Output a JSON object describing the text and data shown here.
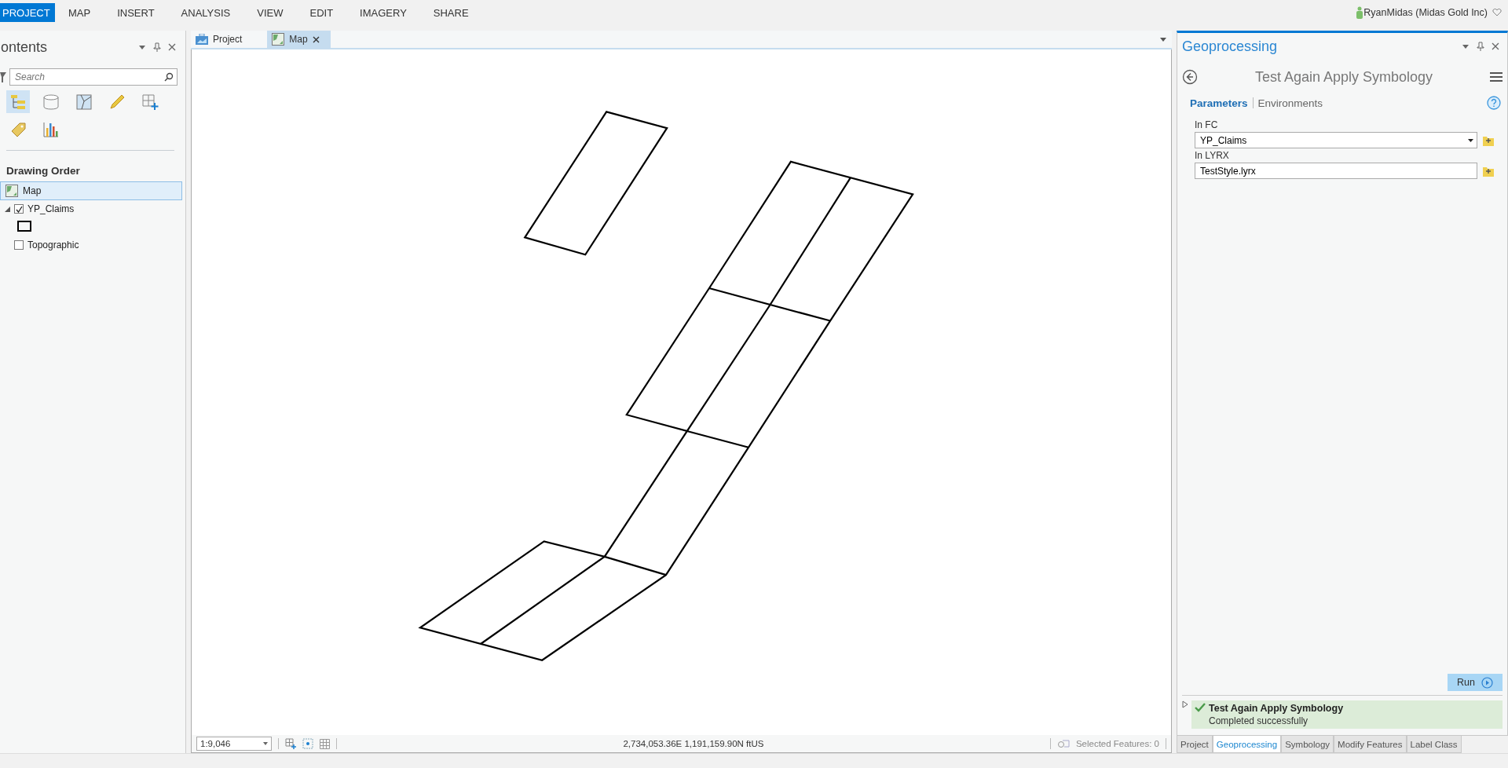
{
  "ribbon": {
    "tabs": [
      {
        "label": "PROJECT",
        "selected": true
      },
      {
        "label": "MAP",
        "selected": false
      },
      {
        "label": "INSERT",
        "selected": false
      },
      {
        "label": "ANALYSIS",
        "selected": false
      },
      {
        "label": "VIEW",
        "selected": false
      },
      {
        "label": "EDIT",
        "selected": false
      },
      {
        "label": "IMAGERY",
        "selected": false
      },
      {
        "label": "SHARE",
        "selected": false
      }
    ],
    "user": "RyanMidas (Midas Gold Inc)"
  },
  "contents": {
    "title": "ontents",
    "search": {
      "placeholder": "Search"
    },
    "view_buttons": [
      {
        "kind": "drawing-order",
        "selected": true
      },
      {
        "kind": "data-source",
        "selected": false
      },
      {
        "kind": "selection",
        "selected": false
      },
      {
        "kind": "editing",
        "selected": false
      },
      {
        "kind": "snapping",
        "selected": false
      },
      {
        "kind": "labeling",
        "selected": false
      },
      {
        "kind": "charts",
        "selected": false
      }
    ],
    "section": "Drawing Order",
    "tree": [
      {
        "label": "Map",
        "kind": "map",
        "selected": true,
        "children": [
          {
            "label": "YP_Claims",
            "kind": "layer",
            "checked": true,
            "expanded": true,
            "selected": false
          },
          {
            "label": "Topographic",
            "kind": "layer",
            "checked": false,
            "expanded": false,
            "selected": false
          }
        ]
      }
    ]
  },
  "view_tabs": [
    {
      "label": "Project",
      "kind": "project",
      "selected": false
    },
    {
      "label": "Map",
      "kind": "map",
      "selected": true
    }
  ],
  "status_bar": {
    "scale": "1:9,046",
    "coordinates": "2,734,053.36E 1,191,159.90N ftUS",
    "selected_features": "Selected Features: 0"
  },
  "geoprocessing": {
    "title": "Geoprocessing",
    "tool": "Test Again Apply Symbology",
    "tabs": [
      {
        "label": "Parameters",
        "selected": true
      },
      {
        "label": "Environments",
        "selected": false
      }
    ],
    "parameters": [
      {
        "label": "In FC",
        "value": "YP_Claims",
        "kind": "dropdown"
      },
      {
        "label": "In LYRX",
        "value": "TestStyle.lyrx",
        "kind": "text"
      }
    ],
    "run": "Run",
    "message": {
      "title": "Test Again Apply Symbology",
      "status": "Completed successfully",
      "expanded": false
    }
  },
  "pane_tabs": [
    {
      "label": "Project",
      "selected": false
    },
    {
      "label": "Geoprocessing",
      "selected": true
    },
    {
      "label": "Symbology",
      "selected": false
    },
    {
      "label": "Modify Features",
      "selected": false
    },
    {
      "label": "Label Class",
      "selected": false
    }
  ]
}
